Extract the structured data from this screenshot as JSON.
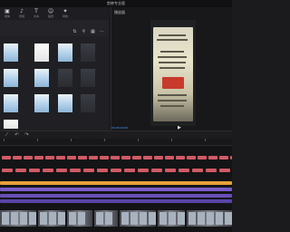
{
  "window": {
    "title": "剪映专业版"
  },
  "toolbar": {
    "items": [
      {
        "icon": "media-icon",
        "glyph": "▣",
        "label": "媒体"
      },
      {
        "icon": "audio-icon",
        "glyph": "♪",
        "label": "音频"
      },
      {
        "icon": "text-icon",
        "glyph": "T",
        "label": "文本"
      },
      {
        "icon": "sticker-icon",
        "glyph": "☺",
        "label": "贴纸"
      },
      {
        "icon": "effects-icon",
        "glyph": "✦",
        "label": "特效"
      }
    ]
  },
  "media": {
    "thumbnails": [
      {
        "style": "light"
      },
      {
        "style": "white"
      },
      {
        "style": "light"
      },
      {
        "style": "dark"
      },
      {
        "style": "light"
      },
      {
        "style": "light"
      },
      {
        "style": "dark"
      },
      {
        "style": "dark"
      },
      {
        "style": "light"
      },
      {
        "style": "light"
      },
      {
        "style": "light"
      },
      {
        "style": "dark"
      },
      {
        "style": "white"
      }
    ]
  },
  "preview": {
    "title": "播放器",
    "timecode": "00:00:00:00",
    "play_glyph": "▶"
  },
  "colors": {
    "accent": "#4ea1ff",
    "clip_red": "#d25a66",
    "track_purple": "#7a5cc8",
    "track_orange": "#e8a03a",
    "track_violet": "#6a4fb5"
  }
}
